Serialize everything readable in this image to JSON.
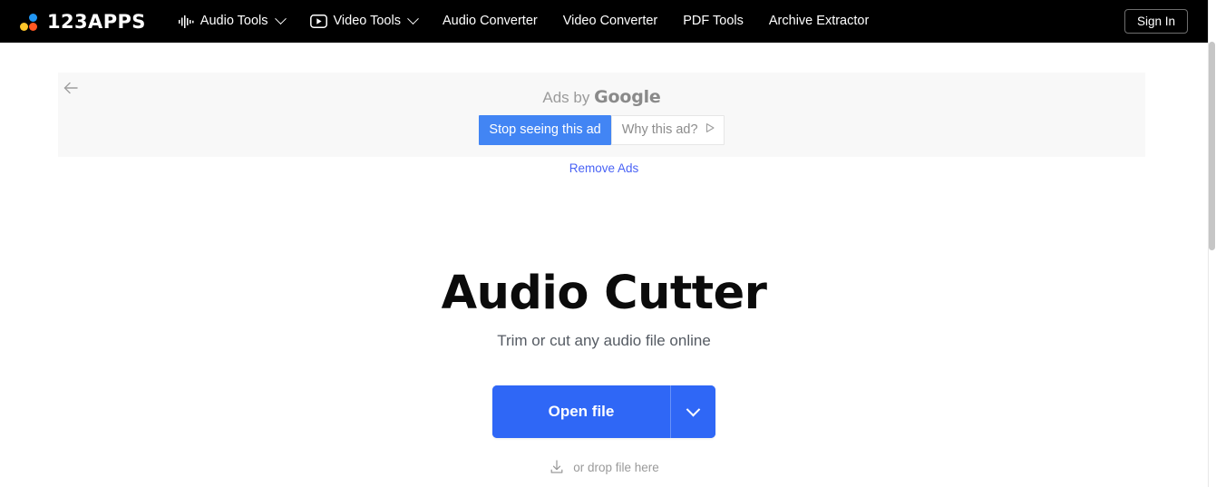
{
  "header": {
    "logo": {
      "text": "123APPS",
      "dot_blue": "#2196f3",
      "dot_yellow": "#ffc629",
      "dot_red": "#ff5722"
    },
    "nav": [
      {
        "label": "Audio Tools",
        "icon": "audio-waveform-icon",
        "has_dropdown": true
      },
      {
        "label": "Video Tools",
        "icon": "play-box-icon",
        "has_dropdown": true
      },
      {
        "label": "Audio Converter",
        "icon": null,
        "has_dropdown": false
      },
      {
        "label": "Video Converter",
        "icon": null,
        "has_dropdown": false
      },
      {
        "label": "PDF Tools",
        "icon": null,
        "has_dropdown": false
      },
      {
        "label": "Archive Extractor",
        "icon": null,
        "has_dropdown": false
      }
    ],
    "sign_in_label": "Sign In",
    "background": "#000000"
  },
  "ad": {
    "back_icon": "arrow-left-icon",
    "ads_by_prefix": "Ads by ",
    "ads_by_brand": "Google",
    "stop_button_label": "Stop seeing this ad",
    "why_button_label": "Why this ad?",
    "why_button_icon": "play-triangle-outline-icon",
    "stop_button_color": "#4285f4",
    "background": "#f8f8f8"
  },
  "remove_ads": {
    "label": "Remove Ads",
    "color": "#4a63f5"
  },
  "hero": {
    "title": "Audio Cutter",
    "subtitle": "Trim or cut any audio file online",
    "open_file_label": "Open file",
    "open_file_color": "#2f67f6",
    "dropdown_icon": "chevron-down-icon",
    "drop_hint": "or drop file here",
    "drop_icon": "download-tray-icon"
  }
}
